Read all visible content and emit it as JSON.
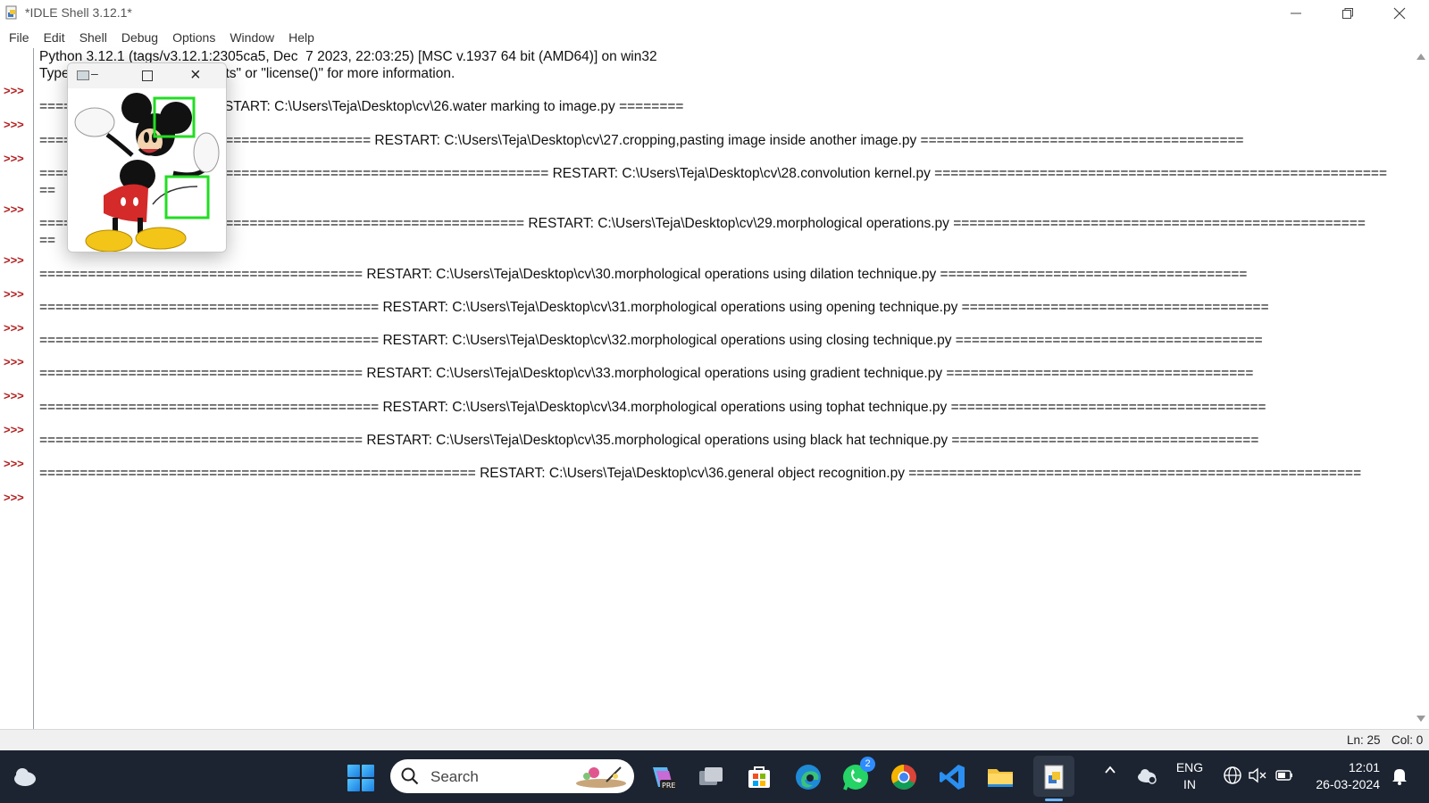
{
  "window": {
    "title": "*IDLE Shell 3.12.1*",
    "controls": [
      "minimize-icon",
      "maximize-icon",
      "close-icon"
    ]
  },
  "menu": {
    "items": [
      "File",
      "Edit",
      "Shell",
      "Debug",
      "Options",
      "Window",
      "Help"
    ]
  },
  "shell": {
    "prompt": ">>>",
    "lines": [
      "Python 3.12.1 (tags/v3.12.1:2305ca5, Dec  7 2023, 22:03:25) [MSC v.1937 64 bit (AMD64)] on win32",
      "Type \"help\", \"copyright\", \"credits\" or \"license()\" for more information.",
      "==================== RESTART: C:\\Users\\Teja\\Desktop\\cv\\26.water marking to image.py ========",
      "========================================= RESTART: C:\\Users\\Teja\\Desktop\\cv\\27.cropping,pasting image inside another image.py ========================================",
      "=============================================================== RESTART: C:\\Users\\Teja\\Desktop\\cv\\28.convolution kernel.py ========================================================",
      "==",
      "============================================================ RESTART: C:\\Users\\Teja\\Desktop\\cv\\29.morphological operations.py ===================================================",
      "==",
      "======================================== RESTART: C:\\Users\\Teja\\Desktop\\cv\\30.morphological operations using dilation technique.py ======================================",
      "========================================== RESTART: C:\\Users\\Teja\\Desktop\\cv\\31.morphological operations using opening technique.py ======================================",
      "========================================== RESTART: C:\\Users\\Teja\\Desktop\\cv\\32.morphological operations using closing technique.py ======================================",
      "======================================== RESTART: C:\\Users\\Teja\\Desktop\\cv\\33.morphological operations using gradient technique.py ======================================",
      "========================================== RESTART: C:\\Users\\Teja\\Desktop\\cv\\34.morphological operations using tophat technique.py =======================================",
      "======================================== RESTART: C:\\Users\\Teja\\Desktop\\cv\\35.morphological operations using black hat technique.py ======================================",
      "====================================================== RESTART: C:\\Users\\Teja\\Desktop\\cv\\36.general object recognition.py ========================================================"
    ]
  },
  "status": {
    "line": "Ln: 25",
    "col": "Col: 0"
  },
  "image_window": {
    "icons": [
      "window-app-icon",
      "minimize-icon",
      "maximize-icon",
      "close-icon"
    ],
    "content": "mickey-mouse-image-with-green-detection-boxes",
    "box_color": "#22dd22"
  },
  "taskbar": {
    "search_label": "Search",
    "apps": [
      "start-icon",
      "copilot-icon",
      "task-view-icon",
      "store-icon",
      "edge-icon",
      "whatsapp-icon",
      "chrome-icon",
      "vscode-icon",
      "file-explorer-icon",
      "python-idle-icon"
    ],
    "whatsapp_badge": "2",
    "tray": {
      "lang_top": "ENG",
      "lang_bottom": "IN",
      "time": "12:01",
      "date": "26-03-2024"
    },
    "colors": {
      "background": "#1c2431",
      "accent": "#2f8cff"
    }
  }
}
